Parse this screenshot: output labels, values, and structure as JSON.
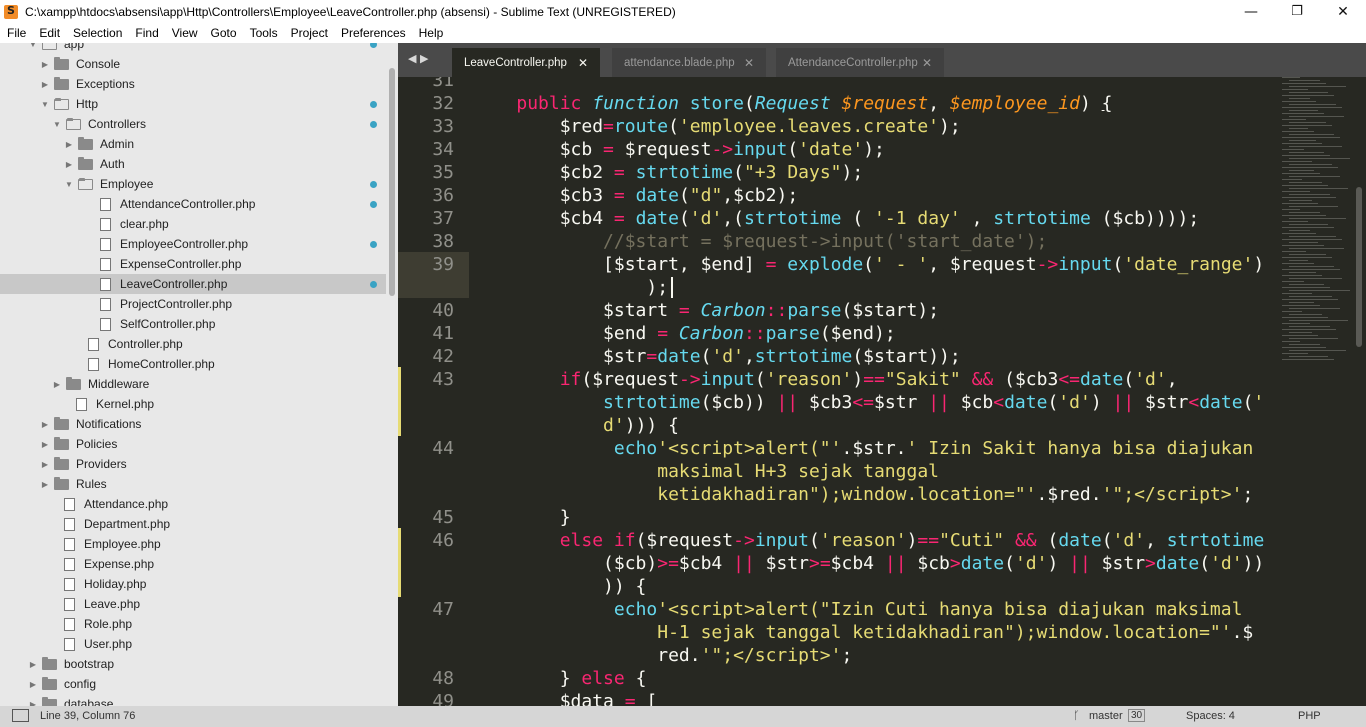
{
  "window": {
    "title": "C:\\xampp\\htdocs\\absensi\\app\\Http\\Controllers\\Employee\\LeaveController.php (absensi) - Sublime Text (UNREGISTERED)",
    "minimize": "—",
    "maximize": "❐",
    "close": "✕"
  },
  "menu": [
    "File",
    "Edit",
    "Selection",
    "Find",
    "View",
    "Goto",
    "Tools",
    "Project",
    "Preferences",
    "Help"
  ],
  "sidebar": {
    "items": [
      {
        "label": "app",
        "kind": "folder-open",
        "depth": 0,
        "dot": true
      },
      {
        "label": "Console",
        "kind": "folder",
        "depth": 1,
        "dot": false
      },
      {
        "label": "Exceptions",
        "kind": "folder",
        "depth": 1,
        "dot": false
      },
      {
        "label": "Http",
        "kind": "folder-open",
        "depth": 1,
        "dot": true
      },
      {
        "label": "Controllers",
        "kind": "folder-open",
        "depth": 2,
        "dot": true
      },
      {
        "label": "Admin",
        "kind": "folder",
        "depth": 3,
        "dot": false
      },
      {
        "label": "Auth",
        "kind": "folder",
        "depth": 3,
        "dot": false
      },
      {
        "label": "Employee",
        "kind": "folder-open",
        "depth": 3,
        "dot": true
      },
      {
        "label": "AttendanceController.php",
        "kind": "file",
        "depth": 4,
        "dot": true
      },
      {
        "label": "clear.php",
        "kind": "file",
        "depth": 4,
        "dot": false
      },
      {
        "label": "EmployeeController.php",
        "kind": "file",
        "depth": 4,
        "dot": true
      },
      {
        "label": "ExpenseController.php",
        "kind": "file",
        "depth": 4,
        "dot": false
      },
      {
        "label": "LeaveController.php",
        "kind": "file",
        "depth": 4,
        "dot": true,
        "selected": true
      },
      {
        "label": "ProjectController.php",
        "kind": "file",
        "depth": 4,
        "dot": false
      },
      {
        "label": "SelfController.php",
        "kind": "file",
        "depth": 4,
        "dot": false
      },
      {
        "label": "Controller.php",
        "kind": "file",
        "depth": 3,
        "dot": false
      },
      {
        "label": "HomeController.php",
        "kind": "file",
        "depth": 3,
        "dot": false
      },
      {
        "label": "Middleware",
        "kind": "folder",
        "depth": 2,
        "dot": false
      },
      {
        "label": "Kernel.php",
        "kind": "file",
        "depth": 2,
        "dot": false
      },
      {
        "label": "Notifications",
        "kind": "folder",
        "depth": 1,
        "dot": false
      },
      {
        "label": "Policies",
        "kind": "folder",
        "depth": 1,
        "dot": false
      },
      {
        "label": "Providers",
        "kind": "folder",
        "depth": 1,
        "dot": false
      },
      {
        "label": "Rules",
        "kind": "folder",
        "depth": 1,
        "dot": false
      },
      {
        "label": "Attendance.php",
        "kind": "file",
        "depth": 1,
        "dot": false
      },
      {
        "label": "Department.php",
        "kind": "file",
        "depth": 1,
        "dot": false
      },
      {
        "label": "Employee.php",
        "kind": "file",
        "depth": 1,
        "dot": false
      },
      {
        "label": "Expense.php",
        "kind": "file",
        "depth": 1,
        "dot": false
      },
      {
        "label": "Holiday.php",
        "kind": "file",
        "depth": 1,
        "dot": false
      },
      {
        "label": "Leave.php",
        "kind": "file",
        "depth": 1,
        "dot": false
      },
      {
        "label": "Role.php",
        "kind": "file",
        "depth": 1,
        "dot": false
      },
      {
        "label": "User.php",
        "kind": "file",
        "depth": 1,
        "dot": false
      },
      {
        "label": "bootstrap",
        "kind": "folder",
        "depth": 0,
        "dot": false
      },
      {
        "label": "config",
        "kind": "folder",
        "depth": 0,
        "dot": false
      },
      {
        "label": "database",
        "kind": "folder",
        "depth": 0,
        "dot": false
      }
    ]
  },
  "tabs": [
    {
      "label": "LeaveController.php",
      "active": true
    },
    {
      "label": "attendance.blade.php",
      "active": false
    },
    {
      "label": "AttendanceController.php",
      "active": false
    }
  ],
  "tab_nav": "◀ ▶",
  "tab_close": "✕",
  "editor": {
    "lines": [
      {
        "num": "31",
        "html": ""
      },
      {
        "num": "32",
        "html": "    <span class=\"k\">public</span> <span class=\"fi\">function</span> <span class=\"f\">store</span>(<span class=\"fi\">Request</span> <span class=\"p\">$request</span>, <span class=\"p\">$employee_id</span>) <span class=\"u\">{</span>"
      },
      {
        "num": "33",
        "html": "        $red<span class=\"k\">=</span><span class=\"f\">route</span>(<span class=\"s\">'employee.leaves.create'</span>);"
      },
      {
        "num": "34",
        "html": "        $cb <span class=\"k\">=</span> $request<span class=\"k\">-&gt;</span><span class=\"f\">input</span>(<span class=\"s\">'date'</span>);"
      },
      {
        "num": "35",
        "html": "        $cb2 <span class=\"k\">=</span> <span class=\"f\">strtotime</span>(<span class=\"s\">\"+3 Days\"</span>);"
      },
      {
        "num": "36",
        "html": "        $cb3 <span class=\"k\">=</span> <span class=\"f\">date</span>(<span class=\"s\">\"d\"</span>,$cb2);"
      },
      {
        "num": "37",
        "html": "        $cb4 <span class=\"k\">=</span> <span class=\"f\">date</span>(<span class=\"s\">'d'</span>,(<span class=\"f\">strtotime</span> ( <span class=\"s\">'-1 day'</span> , <span class=\"f\">strtotime</span> ($cb))));"
      },
      {
        "num": "38",
        "html": "            <span class=\"cm\">//$start = $request-&gt;input('start_date');</span>"
      },
      {
        "num": "39",
        "html": "            [$start, $end] <span class=\"k\">=</span> <span class=\"f\">explode</span>(<span class=\"s\">' - '</span>, $request<span class=\"k\">-&gt;</span><span class=\"f\">input</span>(<span class=\"s\">'date_range'</span>)"
      },
      {
        "num": "",
        "html": "                );"
      },
      {
        "num": "40",
        "html": "            $start <span class=\"k\">=</span> <span class=\"fi\">Carbon</span><span class=\"k\">::</span><span class=\"f\">parse</span>($start);"
      },
      {
        "num": "41",
        "html": "            $end <span class=\"k\">=</span> <span class=\"fi\">Carbon</span><span class=\"k\">::</span><span class=\"f\">parse</span>($end);"
      },
      {
        "num": "42",
        "html": "            $str<span class=\"k\">=</span><span class=\"f\">date</span>(<span class=\"s\">'d'</span>,<span class=\"f\">strtotime</span>($start));"
      },
      {
        "num": "43",
        "html": "        <span class=\"k\">if</span>($request<span class=\"k\">-&gt;</span><span class=\"f\">input</span>(<span class=\"s\">'reason'</span>)<span class=\"k\">==</span><span class=\"s\">\"Sakit\"</span> <span class=\"k\">&amp;&amp;</span> ($cb3<span class=\"k\">&lt;=</span><span class=\"f\">date</span>(<span class=\"s\">'d'</span>,"
      },
      {
        "num": "",
        "html": "            <span class=\"f\">strtotime</span>($cb)) <span class=\"k\">||</span> $cb3<span class=\"k\">&lt;=</span>$str <span class=\"k\">||</span> $cb<span class=\"k\">&lt;</span><span class=\"f\">date</span>(<span class=\"s\">'d'</span>) <span class=\"k\">||</span> $str<span class=\"k\">&lt;</span><span class=\"f\">date</span>(<span class=\"s\">'</span>"
      },
      {
        "num": "",
        "html": "            <span class=\"s\">d'</span>))) {"
      },
      {
        "num": "44",
        "html": "             <span class=\"f\">echo</span><span class=\"s\">'&lt;script&gt;alert(\"'</span>.$str.<span class=\"s\">' Izin Sakit hanya bisa diajukan</span>"
      },
      {
        "num": "",
        "html": "<span class=\"s\">                 maksimal H+3 sejak tanggal</span>"
      },
      {
        "num": "",
        "html": "<span class=\"s\">                 ketidakhadiran\");window.location=\"'</span>.$red.<span class=\"s\">'\";&lt;/script&gt;'</span>;"
      },
      {
        "num": "45",
        "html": "        }"
      },
      {
        "num": "46",
        "html": "        <span class=\"k\">else</span> <span class=\"k\">if</span>($request<span class=\"k\">-&gt;</span><span class=\"f\">input</span>(<span class=\"s\">'reason'</span>)<span class=\"k\">==</span><span class=\"s\">\"Cuti\"</span> <span class=\"k\">&amp;&amp;</span> (<span class=\"f\">date</span>(<span class=\"s\">'d'</span>, <span class=\"f\">strtotime</span>"
      },
      {
        "num": "",
        "html": "            ($cb)<span class=\"k\">&gt;=</span>$cb4 <span class=\"k\">||</span> $str<span class=\"k\">&gt;=</span>$cb4 <span class=\"k\">||</span> $cb<span class=\"k\">&gt;</span><span class=\"f\">date</span>(<span class=\"s\">'d'</span>) <span class=\"k\">||</span> $str<span class=\"k\">&gt;</span><span class=\"f\">date</span>(<span class=\"s\">'d'</span>))"
      },
      {
        "num": "",
        "html": "            )) {"
      },
      {
        "num": "47",
        "html": "             <span class=\"f\">echo</span><span class=\"s\">'&lt;script&gt;alert(\"Izin Cuti hanya bisa diajukan maksimal</span>"
      },
      {
        "num": "",
        "html": "<span class=\"s\">                 H-1 sejak tanggal ketidakhadiran\");window.location=\"'</span>.$"
      },
      {
        "num": "",
        "html": "                 red.<span class=\"s\">'\";&lt;/script&gt;'</span>;"
      },
      {
        "num": "48",
        "html": "        } <span class=\"k\">else</span> {"
      },
      {
        "num": "49",
        "html": "        $data <span class=\"k\">=</span> ["
      }
    ]
  },
  "status": {
    "position": "Line 39, Column 76",
    "branch": "master",
    "branch_count": "30",
    "indent": "Spaces: 4",
    "syntax": "PHP"
  },
  "colors": {
    "editor_bg": "#272822",
    "keyword": "#f92672",
    "function": "#66d9ef",
    "string": "#e6db74",
    "parameter": "#fd971f",
    "comment": "#75715e",
    "sidebar_dot": "#3aa3c4"
  }
}
